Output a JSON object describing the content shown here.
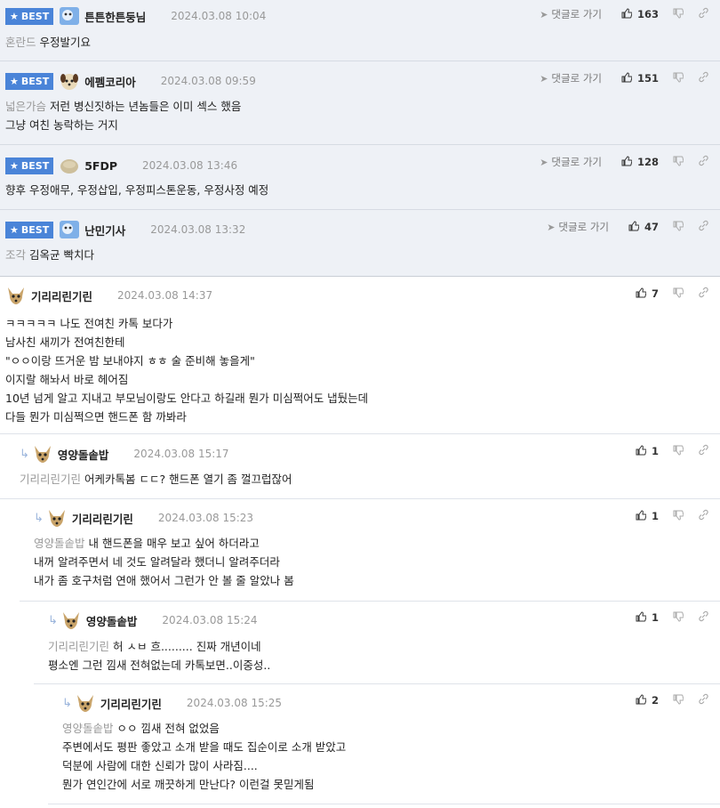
{
  "best_label": "BEST",
  "goto_label": "댓글로 가기",
  "comments": [
    {
      "nick": "튼튼한튼둥님",
      "date": "2024.03.08 10:04",
      "likes": "163",
      "reply_to": "혼란드",
      "lines": [
        "우정발기요"
      ]
    },
    {
      "nick": "에펨코리아",
      "date": "2024.03.08 09:59",
      "likes": "151",
      "reply_to": "넓은가슴",
      "lines": [
        "저런 병신짓하는 년놈들은 이미 섹스 했음",
        "그냥 여친 농락하는 거지"
      ]
    },
    {
      "nick": "5FDP",
      "date": "2024.03.08 13:46",
      "likes": "128",
      "reply_to": "",
      "lines": [
        "향후 우정애무, 우정삽입, 우정피스톤운동, 우정사정 예정"
      ]
    },
    {
      "nick": "난민기사",
      "date": "2024.03.08 13:32",
      "likes": "47",
      "reply_to": "조각",
      "lines": [
        "김옥균 빡치다"
      ]
    },
    {
      "nick": "기리리린기린",
      "date": "2024.03.08 14:37",
      "likes": "7",
      "reply_to": "",
      "lines": [
        "ㅋㅋㅋㅋㅋ 나도 전여친 카톡 보다가",
        "남사친 새끼가 전여친한테",
        "\"ㅇㅇ이랑 뜨거운 밤 보내야지 ㅎㅎ 술 준비해 놓을게\"",
        "이지랄 해놔서 바로 헤어짐",
        "10년 넘게 알고 지내고 부모님이랑도 안다고 하길래 뭔가 미심쩍어도 냅뒀는데",
        "다들 뭔가 미심쩍으면 핸드폰 함 까봐라"
      ]
    },
    {
      "nick": "영양돌솥밥",
      "date": "2024.03.08 15:17",
      "likes": "1",
      "reply_to": "기리리린기린",
      "lines": [
        "어케카톡봄 ㄷㄷ? 핸드폰 열기 좀 껄끄럽잖어"
      ]
    },
    {
      "nick": "기리리린기린",
      "date": "2024.03.08 15:23",
      "likes": "1",
      "reply_to": "영양돌솥밥",
      "lines": [
        "내 핸드폰을 매우 보고 싶어 하더라고",
        "내꺼 알려주면서 네 것도 알려달라 했더니 알려주더라",
        "내가 좀 호구처럼 연애 했어서 그런가 안 볼 줄 알았나 봄"
      ]
    },
    {
      "nick": "영양돌솥밥",
      "date": "2024.03.08 15:24",
      "likes": "1",
      "reply_to": "기리리린기린",
      "lines": [
        "허 ㅅㅂ 흐......... 진짜 개년이네",
        "평소엔 그런 낌새 전혀없는데 카톡보면..이중성.."
      ]
    },
    {
      "nick": "기리리린기린",
      "date": "2024.03.08 15:25",
      "likes": "2",
      "reply_to": "영양돌솥밥",
      "lines": [
        "ㅇㅇ 낌새 전혀 없었음",
        "주변에서도 평판 좋았고 소개 받을 때도 집순이로 소개 받았고",
        "덕분에 사람에 대한 신뢰가 많이 사라짐....",
        "뭔가 연인간에 서로 깨끗하게 만난다? 이런걸 못믿게됨"
      ]
    }
  ]
}
